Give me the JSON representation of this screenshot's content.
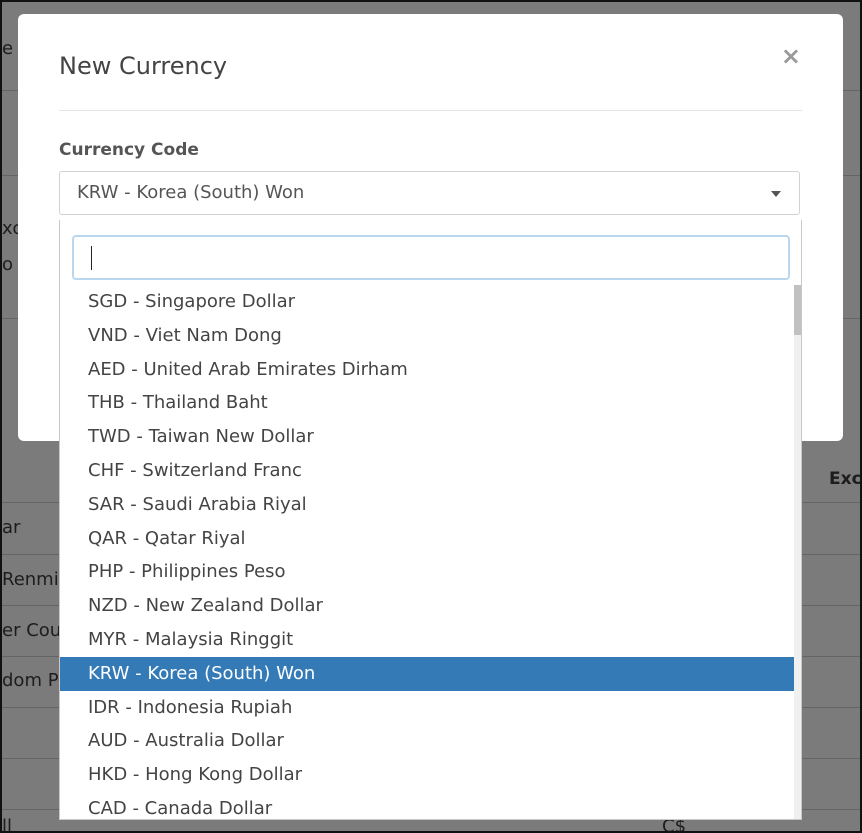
{
  "background": {
    "row_texts": [
      "ar",
      "Renmin",
      "er Coun",
      "dom Po"
    ],
    "header_partial": "Exc",
    "top_partial": "e",
    "side_partials": [
      "xc",
      "o"
    ],
    "bottom_partials": [
      "ll",
      "C$"
    ]
  },
  "modal": {
    "title": "New Currency",
    "close_label": "×",
    "field_label": "Currency Code",
    "selected_value": "KRW - Korea (South) Won"
  },
  "dropdown": {
    "search_value": "",
    "options": [
      "SGD - Singapore Dollar",
      "VND - Viet Nam Dong",
      "AED - United Arab Emirates Dirham",
      "THB - Thailand Baht",
      "TWD - Taiwan New Dollar",
      "CHF - Switzerland Franc",
      "SAR - Saudi Arabia Riyal",
      "QAR - Qatar Riyal",
      "PHP - Philippines Peso",
      "NZD - New Zealand Dollar",
      "MYR - Malaysia Ringgit",
      "KRW - Korea (South) Won",
      "IDR - Indonesia Rupiah",
      "AUD - Australia Dollar",
      "HKD - Hong Kong Dollar",
      "CAD - Canada Dollar"
    ],
    "selected_index": 11
  },
  "colors": {
    "highlight": "#337ab7",
    "search_focus": "#b9d8f0"
  }
}
